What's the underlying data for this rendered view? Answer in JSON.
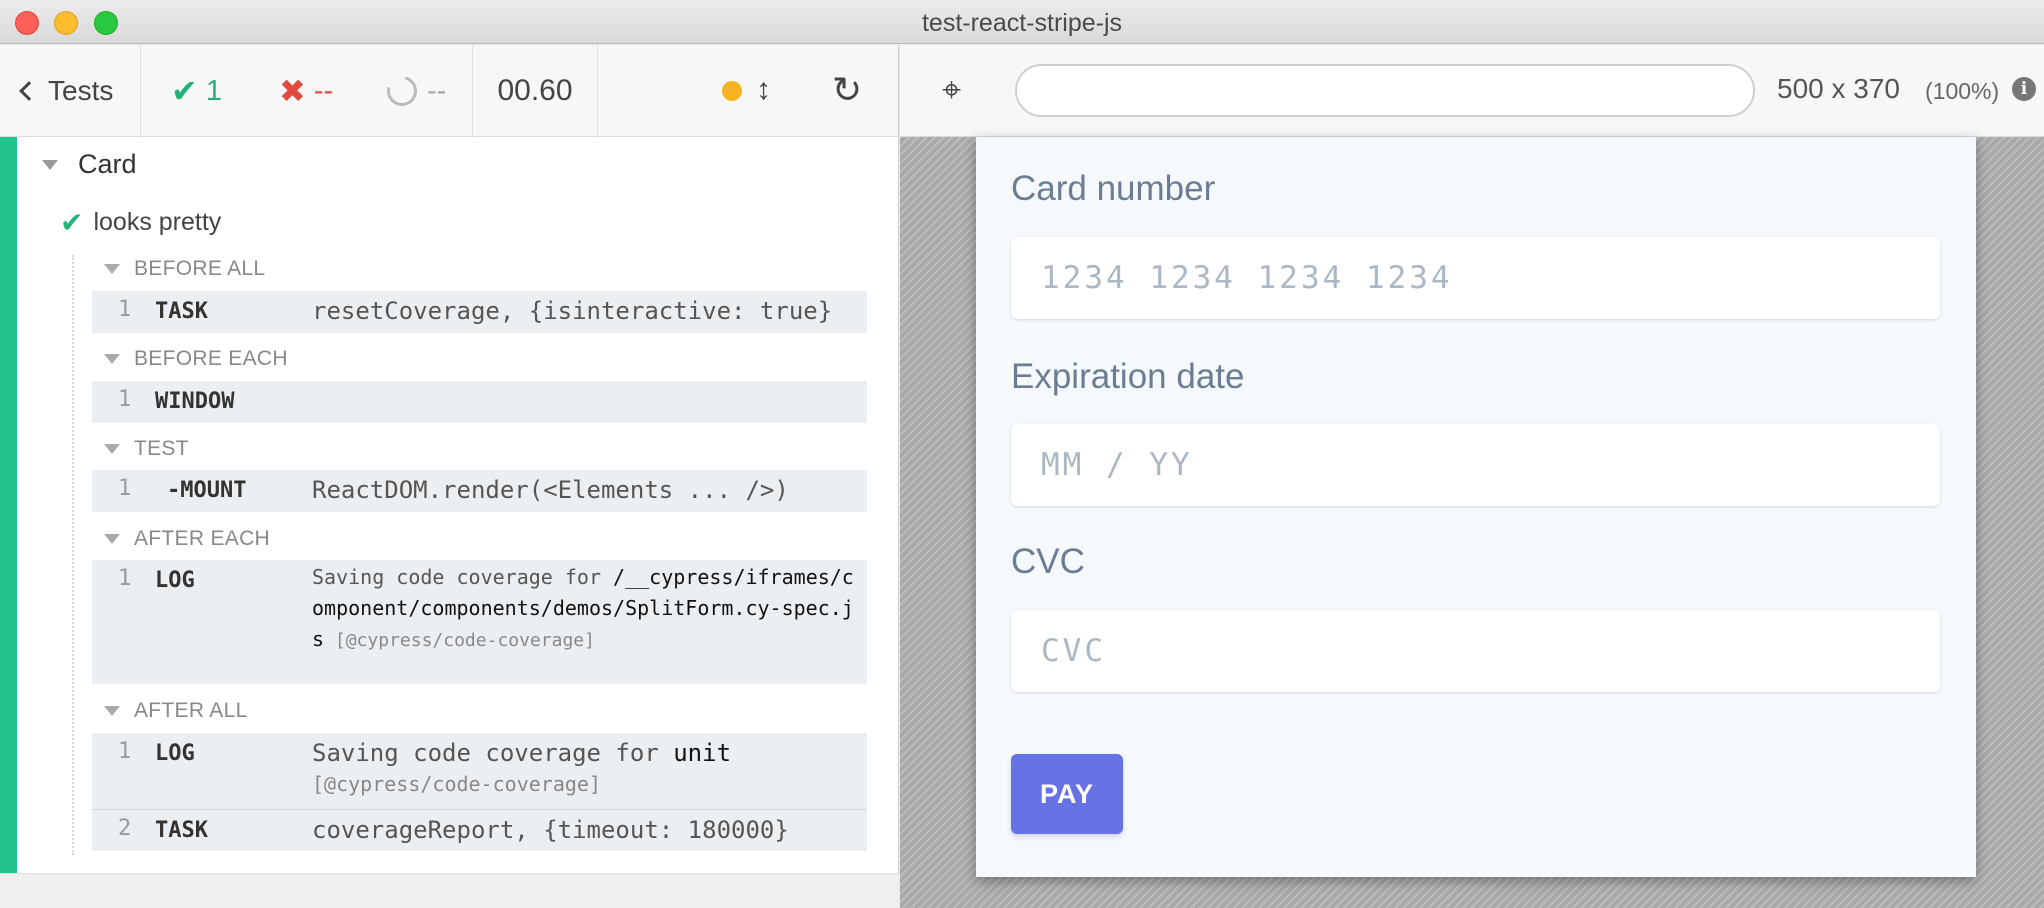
{
  "window": {
    "title": "test-react-stripe-js"
  },
  "header": {
    "back_label": "Tests",
    "passed_count": "1",
    "failed_count": "--",
    "pending_count": "--",
    "duration": "00.60"
  },
  "aut_header": {
    "url": "",
    "viewport_size": "500 x 370",
    "viewport_scale": "(100%)"
  },
  "reporter": {
    "suite_title": "Card",
    "test_title": "looks pretty",
    "hooks": {
      "before_all": {
        "title": "BEFORE ALL",
        "commands": [
          {
            "num": "1",
            "name": "TASK",
            "message": "resetCoverage, {isinteractive: true}"
          }
        ]
      },
      "before_each": {
        "title": "BEFORE EACH",
        "commands": [
          {
            "num": "1",
            "name": "WINDOW",
            "message": ""
          }
        ]
      },
      "test": {
        "title": "TEST",
        "commands": [
          {
            "num": "1",
            "name": "-MOUNT",
            "message": "ReactDOM.render(<Elements ... />)"
          }
        ]
      },
      "after_each": {
        "title": "AFTER EACH",
        "commands": [
          {
            "num": "1",
            "name": "LOG",
            "message_prefix": "Saving code coverage for ",
            "message_path": "/__cypress/iframes/component/components/demos/SplitForm.cy-spec.js",
            "message_suffix": " [@cypress/code-coverage]"
          }
        ]
      },
      "after_all": {
        "title": "AFTER ALL",
        "commands": [
          {
            "num": "1",
            "name": "LOG",
            "message_prefix": "Saving code coverage for ",
            "message_bold": "unit",
            "message_suffix": "[@cypress/code-coverage]"
          },
          {
            "num": "2",
            "name": "TASK",
            "message": "coverageReport, {timeout: 180000}"
          }
        ]
      }
    }
  },
  "form": {
    "card_number_label": "Card number",
    "card_number_placeholder": "1234 1234 1234 1234",
    "expiration_label": "Expiration date",
    "expiration_placeholder": "MM / YY",
    "cvc_label": "CVC",
    "cvc_placeholder": "CVC",
    "pay_label": "PAY"
  },
  "colors": {
    "passed": "#1fb57a",
    "failed": "#e04a3f",
    "running_dot": "#f5b324",
    "pay_button": "#6772e5",
    "suite_bar": "#22c48b"
  },
  "icons": [
    "back-chevron-icon",
    "check-icon",
    "x-icon",
    "spinner-icon",
    "status-dot-icon",
    "vertical-resize-icon",
    "reload-icon",
    "crosshair-icon",
    "info-icon",
    "triangle-down-icon"
  ]
}
